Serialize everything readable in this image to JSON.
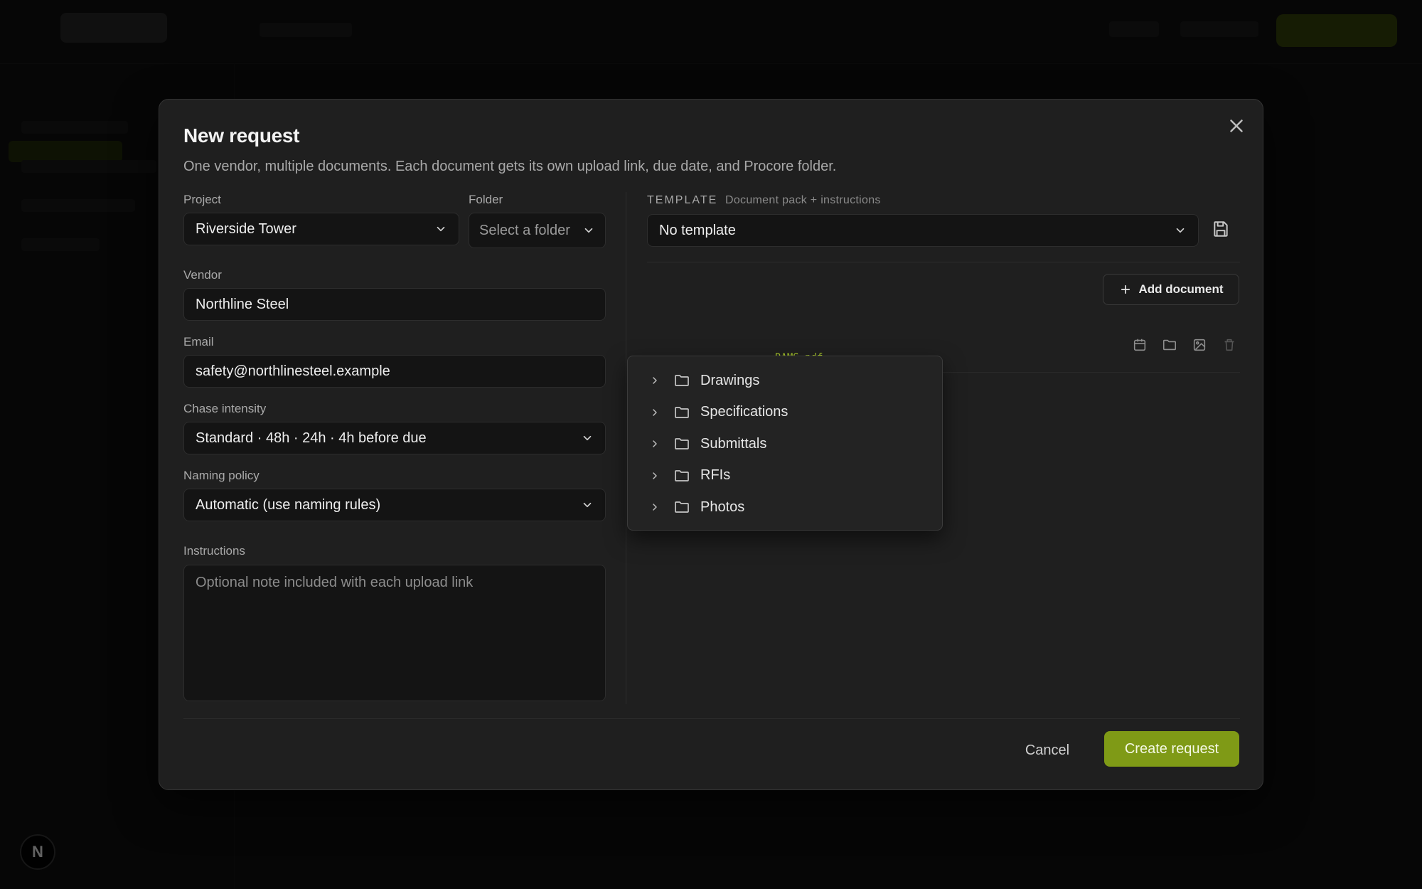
{
  "modal": {
    "title": "New request",
    "subtitle": "One vendor, multiple documents. Each document gets its own upload link, due date, and Procore folder."
  },
  "form": {
    "project_label": "Project",
    "project_value": "Riverside Tower",
    "folder_label": "Folder",
    "folder_placeholder": "Select a folder",
    "vendor_label": "Vendor",
    "vendor_value": "Northline Steel",
    "email_label": "Email",
    "email_value": "safety@northlinesteel.example",
    "chase_label": "Chase intensity",
    "chase_value": "Standard · 48h · 24h · 4h before due",
    "naming_label": "Naming policy",
    "naming_value": "Automatic (use naming rules)",
    "instructions_label": "Instructions",
    "instructions_placeholder": "Optional note included with each upload link"
  },
  "template": {
    "label": "TEMPLATE",
    "sublabel": "Document pack + instructions",
    "value": "No template"
  },
  "documents": {
    "add_label": "Add document",
    "rows": [
      {
        "file_fragment": "RAMS.pdf"
      }
    ]
  },
  "folder_dropdown": {
    "items": [
      {
        "label": "Drawings"
      },
      {
        "label": "Specifications"
      },
      {
        "label": "Submittals"
      },
      {
        "label": "RFIs"
      },
      {
        "label": "Photos"
      }
    ]
  },
  "footer": {
    "cancel_label": "Cancel",
    "create_label": "Create request"
  },
  "background": {
    "badge_letter": "N"
  },
  "colors": {
    "accent": "#7f9a16",
    "accent_text": "#a8c72a",
    "modal_bg": "#1f1f1f"
  }
}
